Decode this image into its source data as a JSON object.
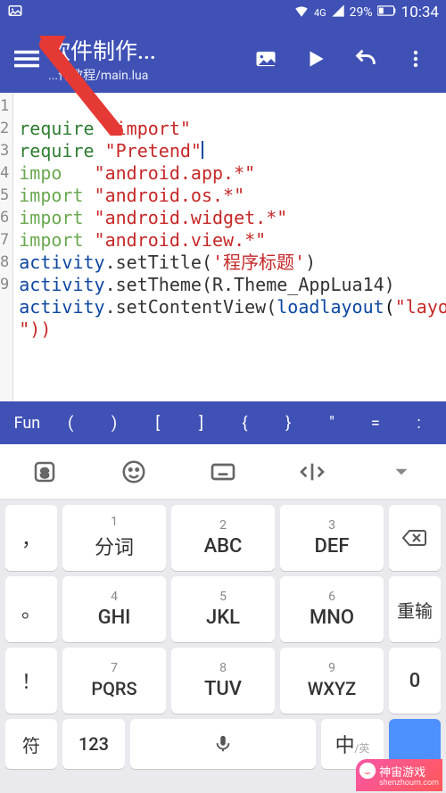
{
  "status": {
    "battery": "29%",
    "clock": "10:34",
    "net": "4G"
  },
  "appbar": {
    "title": "软件制作...",
    "subtitle": "...作教程/main.lua"
  },
  "code": {
    "lines": [
      1,
      2,
      3,
      4,
      5,
      6,
      7,
      8,
      9
    ],
    "l1_kw": "require",
    "l1_str": "\"import\"",
    "l2_kw": "require",
    "l2_str": "\"Pretend\"",
    "l3_kw": "impo",
    "l3_str": "\"android.app.*\"",
    "l4_kw": "import",
    "l4_str": "\"android.os.*\"",
    "l5_kw": "import",
    "l5_str": "\"android.widget.*\"",
    "l6_kw": "import",
    "l6_str": "\"android.view.*\"",
    "l7_obj": "activity",
    "l7_call": ".setTitle(",
    "l7_arg": "'程序标题'",
    "l7_end": ")",
    "l8_obj": "activity",
    "l8_call": ".setTheme(R.Theme_AppLua14)",
    "l9_obj": "activity",
    "l9_call": ".setContentView(",
    "l9_fn": "loadlayout",
    "l9_str": "\"layout",
    "l9_end2": "\"))"
  },
  "quickbar": [
    "Fun",
    "(",
    ")",
    "[",
    "]",
    "{",
    "}",
    "\"",
    "=",
    ":"
  ],
  "kbtop": {
    "items": [
      "s",
      "face",
      "keyboard",
      "split",
      "dropdown"
    ]
  },
  "keys": {
    "r1": [
      {
        "n": "1",
        "l": "分词"
      },
      {
        "n": "2",
        "l": "ABC"
      },
      {
        "n": "3",
        "l": "DEF"
      }
    ],
    "r2": [
      {
        "n": "4",
        "l": "GHI"
      },
      {
        "n": "5",
        "l": "JKL"
      },
      {
        "n": "6",
        "l": "MNO"
      }
    ],
    "r3": [
      {
        "n": "7",
        "l": "PQRS"
      },
      {
        "n": "8",
        "l": "TUV"
      },
      {
        "n": "9",
        "l": "WXYZ"
      }
    ],
    "side_l": [
      "，",
      "。",
      "！"
    ],
    "side_r_bksp": "⌫",
    "side_r_re": "重输",
    "side_r_zero": "0",
    "bottom": {
      "sym": "符",
      "num": "123",
      "space": "",
      "cn": "中",
      "send": ""
    }
  },
  "watermark": {
    "name": "神宙游戏",
    "url": "shenzhoum.com"
  }
}
